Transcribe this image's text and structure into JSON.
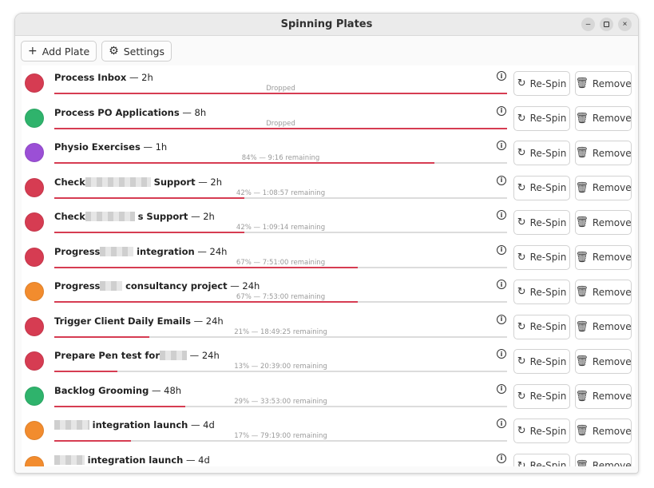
{
  "window": {
    "title": "Spinning Plates",
    "controls": {
      "minimize": "–",
      "close": "×"
    }
  },
  "toolbar": {
    "add_label": "Add Plate",
    "add_icon": "+",
    "settings_label": "Settings",
    "settings_icon": "⚙"
  },
  "actions": {
    "respin_label": "Re-Spin",
    "respin_icon": "↻",
    "remove_label": "Remove",
    "remove_icon": "🗑",
    "info_glyph": "i"
  },
  "colors": {
    "red": "#d63c52",
    "green": "#2fb36c",
    "purple": "#9b4fd6",
    "orange": "#f28c2e"
  },
  "plates": [
    {
      "pre": "Process Inbox",
      "post": "",
      "duration": "2h",
      "status": "Dropped",
      "progress": 1.0,
      "color": "#d63c52"
    },
    {
      "pre": "Process PO Applications",
      "post": "",
      "duration": "8h",
      "status": "Dropped",
      "progress": 1.0,
      "color": "#2fb36c"
    },
    {
      "pre": "Physio Exercises",
      "post": "",
      "duration": "1h",
      "status": "84% — 9:16 remaining",
      "progress": 0.84,
      "color": "#9b4fd6"
    },
    {
      "pre": "Check",
      "post": "Support",
      "duration": "2h",
      "status": "42% — 1:08:57 remaining",
      "progress": 0.42,
      "color": "#d63c52"
    },
    {
      "pre": "Check",
      "post": "s Support",
      "duration": "2h",
      "status": "42% — 1:09:14 remaining",
      "progress": 0.42,
      "color": "#d63c52"
    },
    {
      "pre": "Progress",
      "post": "integration",
      "duration": "24h",
      "status": "67% — 7:51:00 remaining",
      "progress": 0.67,
      "color": "#d63c52"
    },
    {
      "pre": "Progress",
      "post": "consultancy project",
      "duration": "24h",
      "status": "67% — 7:53:00 remaining",
      "progress": 0.67,
      "color": "#f28c2e"
    },
    {
      "pre": "Trigger Client Daily Emails",
      "post": "",
      "duration": "24h",
      "status": "21% — 18:49:25 remaining",
      "progress": 0.21,
      "color": "#d63c52"
    },
    {
      "pre": "Prepare Pen test for",
      "post": "",
      "duration": "24h",
      "status": "13% — 20:39:00 remaining",
      "progress": 0.14,
      "color": "#d63c52"
    },
    {
      "pre": "Backlog Grooming",
      "post": "",
      "duration": "48h",
      "status": "29% — 33:53:00 remaining",
      "progress": 0.29,
      "color": "#2fb36c"
    },
    {
      "pre": "",
      "post": "integration launch",
      "duration": "4d",
      "status": "17% — 79:19:00 remaining",
      "progress": 0.17,
      "color": "#f28c2e"
    },
    {
      "pre": "",
      "post": "integration launch",
      "duration": "4d",
      "status": "",
      "progress": 0.0,
      "color": "#f28c2e"
    }
  ]
}
